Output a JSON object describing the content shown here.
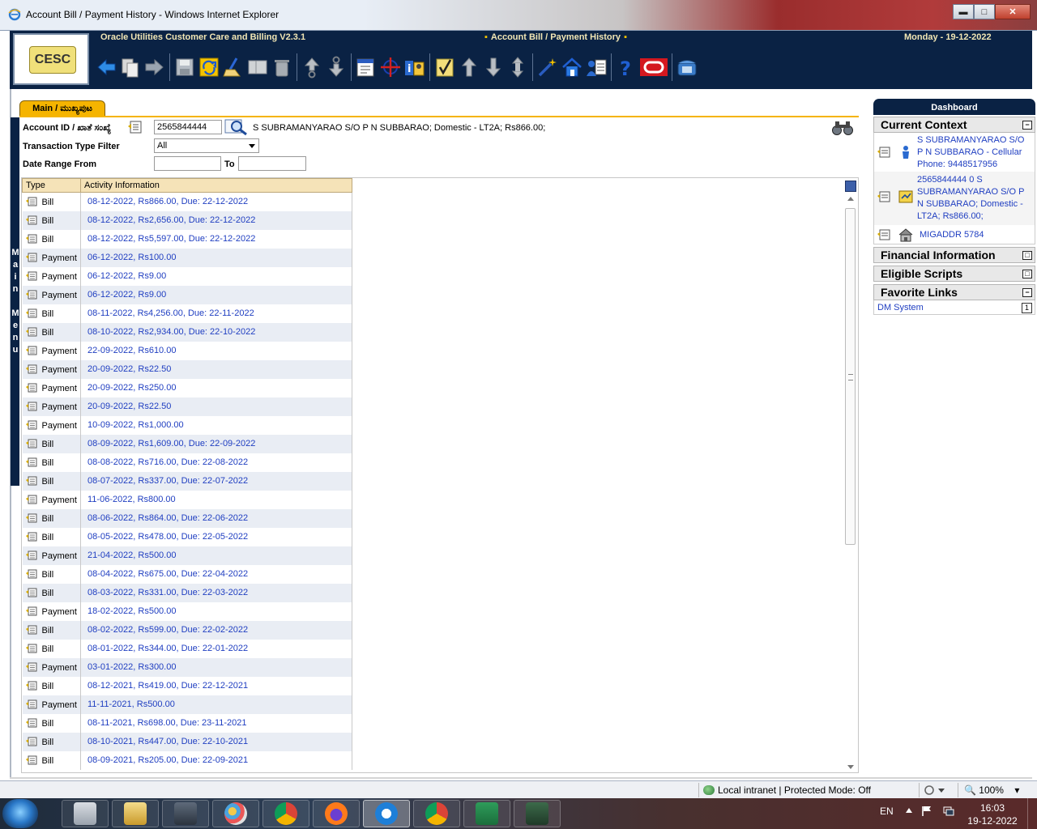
{
  "window": {
    "title": "Account Bill / Payment History - Windows Internet Explorer",
    "controls": {
      "minimize": "▬",
      "maximize": "□",
      "close": "✕"
    }
  },
  "header": {
    "app_name": "Oracle Utilities Customer Care and Billing V2.3.1",
    "page_name": "Account Bill / Payment History",
    "date": "Monday - 19-12-2022",
    "logo_text": "CESC"
  },
  "toolbar": {
    "icons": [
      "back-arrow-icon",
      "copy-icon",
      "forward-arrow-icon",
      "save-icon",
      "refresh-icon",
      "clear-icon",
      "duplicate-icon",
      "delete-icon",
      "goto-previous-icon",
      "goto-next-icon",
      "context-menu-icon",
      "bookmark-icon",
      "alert-info-icon",
      "validate-icon",
      "scroll-up-icon",
      "scroll-down-icon",
      "scroll-both-icon",
      "magic-wand-icon",
      "home-icon",
      "user-preferences-icon",
      "help-icon",
      "oracle-logo-icon",
      "phone-icon"
    ]
  },
  "tabs": [
    {
      "label": "Main / ಮುಖ್ಯಪುಟ",
      "active": true
    }
  ],
  "side_menu": {
    "letters": [
      "M",
      "a",
      "i",
      "n",
      "",
      "M",
      "e",
      "n",
      "u"
    ]
  },
  "filters": {
    "account_id_label": "Account ID / ಖಾತೆ ಸಂಖ್ಯೆ",
    "account_id_value": "2565844444",
    "account_description": "S SUBRAMANYARAO S/O P N SUBBARAO; Domestic - LT2A; Rs866.00;",
    "transaction_type_label": "Transaction Type Filter",
    "transaction_type_value": "All",
    "date_range_from_label": "Date Range From",
    "date_range_from_value": "",
    "to_label": "To",
    "to_value": ""
  },
  "table": {
    "columns": [
      "Type",
      "Activity Information"
    ],
    "rows": [
      {
        "type": "Bill",
        "info": "08-12-2022, Rs866.00, Due: 22-12-2022"
      },
      {
        "type": "Bill",
        "info": "08-12-2022, Rs2,656.00, Due: 22-12-2022"
      },
      {
        "type": "Bill",
        "info": "08-12-2022, Rs5,597.00, Due: 22-12-2022"
      },
      {
        "type": "Payment",
        "info": "06-12-2022, Rs100.00"
      },
      {
        "type": "Payment",
        "info": "06-12-2022, Rs9.00"
      },
      {
        "type": "Payment",
        "info": "06-12-2022, Rs9.00"
      },
      {
        "type": "Bill",
        "info": "08-11-2022, Rs4,256.00, Due: 22-11-2022"
      },
      {
        "type": "Bill",
        "info": "08-10-2022, Rs2,934.00, Due: 22-10-2022"
      },
      {
        "type": "Payment",
        "info": "22-09-2022, Rs610.00"
      },
      {
        "type": "Payment",
        "info": "20-09-2022, Rs22.50"
      },
      {
        "type": "Payment",
        "info": "20-09-2022, Rs250.00"
      },
      {
        "type": "Payment",
        "info": "20-09-2022, Rs22.50"
      },
      {
        "type": "Payment",
        "info": "10-09-2022, Rs1,000.00"
      },
      {
        "type": "Bill",
        "info": "08-09-2022, Rs1,609.00, Due: 22-09-2022"
      },
      {
        "type": "Bill",
        "info": "08-08-2022, Rs716.00, Due: 22-08-2022"
      },
      {
        "type": "Bill",
        "info": "08-07-2022, Rs337.00, Due: 22-07-2022"
      },
      {
        "type": "Payment",
        "info": "11-06-2022, Rs800.00"
      },
      {
        "type": "Bill",
        "info": "08-06-2022, Rs864.00, Due: 22-06-2022"
      },
      {
        "type": "Bill",
        "info": "08-05-2022, Rs478.00, Due: 22-05-2022"
      },
      {
        "type": "Payment",
        "info": "21-04-2022, Rs500.00"
      },
      {
        "type": "Bill",
        "info": "08-04-2022, Rs675.00, Due: 22-04-2022"
      },
      {
        "type": "Bill",
        "info": "08-03-2022, Rs331.00, Due: 22-03-2022"
      },
      {
        "type": "Payment",
        "info": "18-02-2022, Rs500.00"
      },
      {
        "type": "Bill",
        "info": "08-02-2022, Rs599.00, Due: 22-02-2022"
      },
      {
        "type": "Bill",
        "info": "08-01-2022, Rs344.00, Due: 22-01-2022"
      },
      {
        "type": "Payment",
        "info": "03-01-2022, Rs300.00"
      },
      {
        "type": "Bill",
        "info": "08-12-2021, Rs419.00, Due: 22-12-2021"
      },
      {
        "type": "Payment",
        "info": "11-11-2021, Rs500.00"
      },
      {
        "type": "Bill",
        "info": "08-11-2021, Rs698.00, Due: 23-11-2021"
      },
      {
        "type": "Bill",
        "info": "08-10-2021, Rs447.00, Due: 22-10-2021"
      },
      {
        "type": "Bill",
        "info": "08-09-2021, Rs205.00, Due: 22-09-2021"
      }
    ]
  },
  "dashboard": {
    "title": "Dashboard",
    "current_context": {
      "title": "Current Context",
      "toggle": "−",
      "items": [
        {
          "text": "S SUBRAMANYARAO S/O P N SUBBARAO - Cellular Phone: 9448517956",
          "icon": "person-icon"
        },
        {
          "text": "2565844444 0 S SUBRAMANYARAO S/O P N SUBBARAO; Domestic - LT2A; Rs866.00;",
          "icon": "account-icon"
        },
        {
          "text": "MIGADDR 5784",
          "icon": "premise-house-icon"
        }
      ]
    },
    "financial_information": {
      "title": "Financial Information",
      "toggle": "□"
    },
    "eligible_scripts": {
      "title": "Eligible Scripts",
      "toggle": "□"
    },
    "favorite_links": {
      "title": "Favorite Links",
      "toggle": "−",
      "items": [
        {
          "label": "DM System",
          "shortcut": "1"
        }
      ]
    }
  },
  "statusbar": {
    "zone": "Local intranet | Protected Mode: Off",
    "zoom": "100%"
  },
  "taskbar": {
    "apps": [
      "calculator-icon",
      "file-explorer-icon",
      "task-manager-icon",
      "paint-icon",
      "chrome-icon",
      "firefox-icon",
      "internet-explorer-icon",
      "chrome-profile-icon",
      "excel-icon",
      "performance-monitor-icon"
    ],
    "language": "EN",
    "time": "16:03",
    "date": "19-12-2022"
  }
}
